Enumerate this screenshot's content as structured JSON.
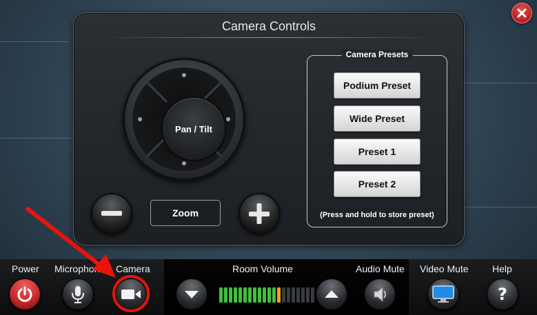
{
  "panel": {
    "title": "Camera Controls"
  },
  "pan_tilt": {
    "label": "Pan / Tilt"
  },
  "zoom": {
    "label": "Zoom"
  },
  "presets": {
    "legend": "Camera Presets",
    "buttons": [
      "Podium Preset",
      "Wide Preset",
      "Preset 1",
      "Preset 2"
    ],
    "note": "(Press and hold to store preset)"
  },
  "bottom_bar": {
    "power_label": "Power",
    "microphone_label": "Microphon",
    "camera_label": "Camera",
    "room_volume_label": "Room Volume",
    "audio_mute_label": "Audio Mute",
    "video_mute_label": "Video Mute",
    "help_label": "Help"
  },
  "volume": {
    "total_segments": 20,
    "level_segments": 13
  },
  "colors": {
    "power_red": "#d32f2f",
    "volume_green": "#3fbf3f",
    "volume_orange": "#f0a020",
    "volume_off": "#3a3d40",
    "highlight_red": "#e8140c",
    "video_blue": "#1e8ce8"
  },
  "icons": {
    "close": "close-icon",
    "power": "power-icon",
    "microphone": "microphone-icon",
    "camera": "video-camera-icon",
    "volume_down": "arrow-down-icon",
    "volume_up": "arrow-up-icon",
    "audio_mute": "speaker-icon",
    "video_mute": "monitor-icon",
    "help": "question-mark-icon",
    "zoom_out": "minus-icon",
    "zoom_in": "plus-icon"
  }
}
